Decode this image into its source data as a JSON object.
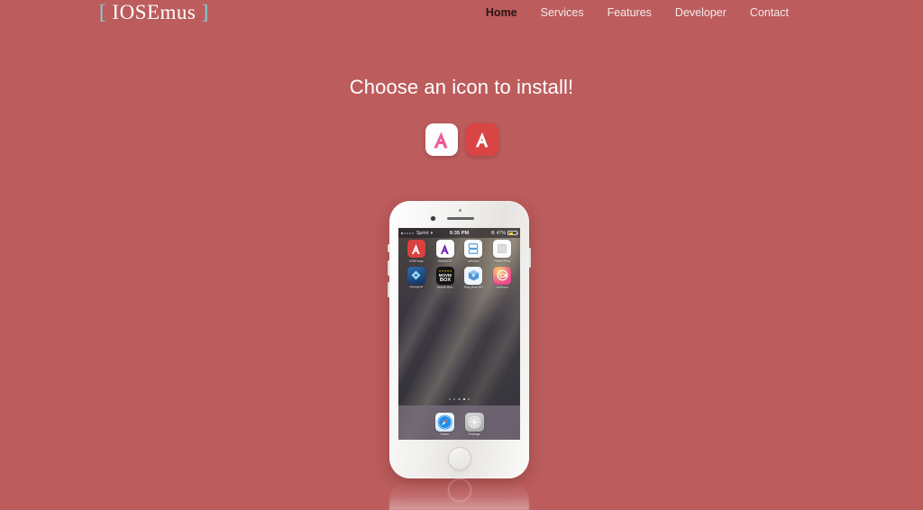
{
  "site": {
    "background_color": "#bc5c5c",
    "logo": {
      "bracket_left": "[",
      "name": "IOSEmus",
      "bracket_right": "]",
      "bracket_color": "#7fd4dd",
      "text_color": "#ffffff"
    }
  },
  "nav": {
    "items": [
      {
        "label": "Home",
        "active": true
      },
      {
        "label": "Services",
        "active": false
      },
      {
        "label": "Features",
        "active": false
      },
      {
        "label": "Developer",
        "active": false
      },
      {
        "label": "Contact",
        "active": false
      }
    ]
  },
  "main": {
    "headline": "Choose an icon to install!",
    "icon_choices": [
      {
        "name": "iosemus-icon-light",
        "style": "light",
        "background": "#fdfdfd",
        "glyph_color": "#e8508f",
        "glyph": "A"
      },
      {
        "name": "iosemus-icon-dark",
        "style": "dark",
        "background": "#d94444",
        "glyph_color": "#ffffff",
        "glyph": "A"
      }
    ]
  },
  "phone": {
    "model_color": "#f2f1ef",
    "status_bar": {
      "carrier": "Sprint",
      "signal_dots": [
        true,
        false,
        false,
        false,
        false
      ],
      "wifi": "▾",
      "time": "9:35 PM",
      "bluetooth": "Ƀ",
      "battery_percent": "47%"
    },
    "apps": [
      {
        "label": "iOSEmus",
        "icon": "iosemus-app-icon",
        "bg": "#d9413f",
        "fg": "#ffffff"
      },
      {
        "label": "GBA4iOS",
        "icon": "gba4ios-app-icon",
        "bg": "#fbfbfb",
        "fg": "#6a23b5"
      },
      {
        "label": "nds4ios",
        "icon": "nds4ios-app-icon",
        "bg": "#fdfdfd",
        "fg": "#4fa3e3"
      },
      {
        "label": "Game Play",
        "icon": "gameplay-app-icon",
        "bg": "#fbfbfb",
        "fg": "#c9c9c9"
      },
      {
        "label": "PPSSPP",
        "icon": "ppsspp-app-icon",
        "bg": "#1b3f6e",
        "fg": "#8fd4ef"
      },
      {
        "label": "Movie Box",
        "icon": "moviebox-app-icon",
        "bg": "#141414",
        "fg": "#f0c419"
      },
      {
        "label": "Play Box HD",
        "icon": "playboxhd-app-icon",
        "bg": "#e9f3fb",
        "fg": "#3e8fd4"
      },
      {
        "label": "AirShou",
        "icon": "airshou-app-icon",
        "bg": "#ec4b8e",
        "fg": "#ffffff"
      }
    ],
    "page_dots": {
      "count": 5,
      "active_index": 3
    },
    "dock": [
      {
        "label": "Safari",
        "icon": "safari-icon"
      },
      {
        "label": "Settings",
        "icon": "settings-gear-icon"
      }
    ]
  }
}
